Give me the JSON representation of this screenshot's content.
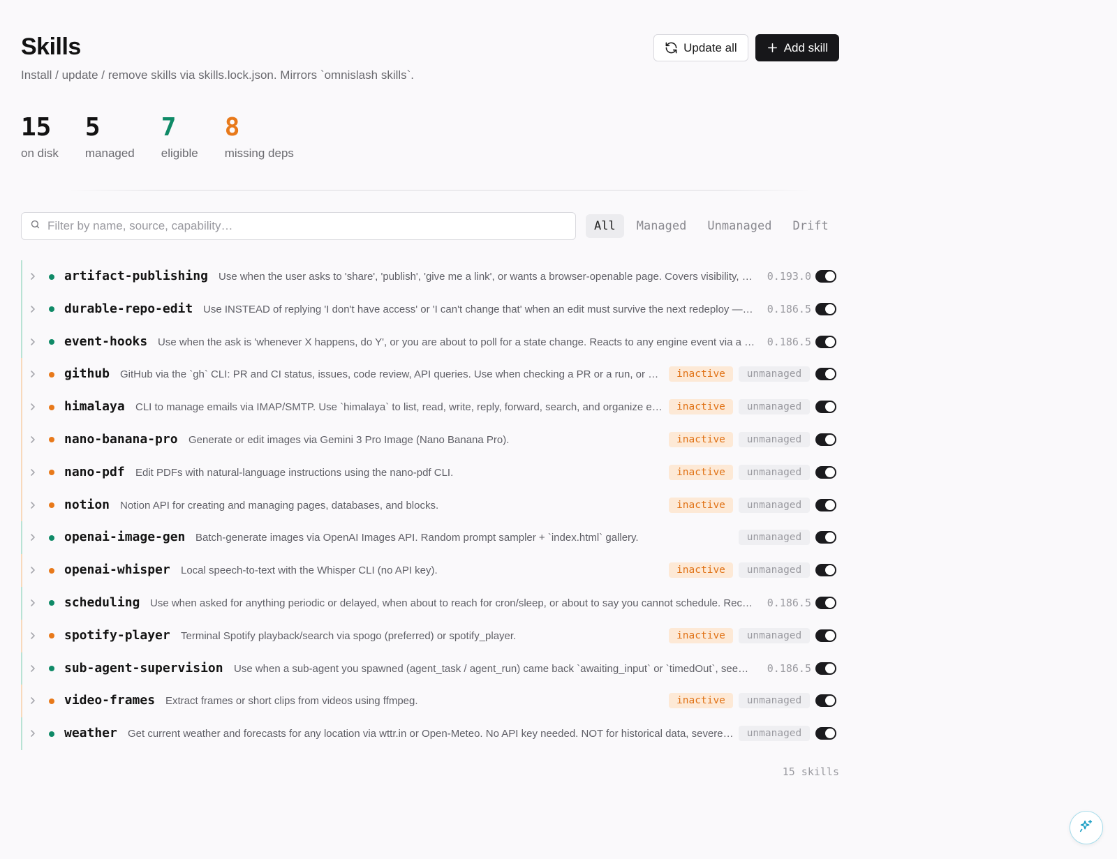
{
  "header": {
    "title": "Skills",
    "subtitle": "Install / update / remove skills via skills.lock.json. Mirrors `omnislash skills`.",
    "update_all_label": "Update all",
    "add_skill_label": "Add skill"
  },
  "stats": [
    {
      "value": "15",
      "label": "on disk",
      "color": "#121212"
    },
    {
      "value": "5",
      "label": "managed",
      "color": "#121212"
    },
    {
      "value": "7",
      "label": "eligible",
      "color": "#0f8a67"
    },
    {
      "value": "8",
      "label": "missing deps",
      "color": "#e8791a"
    }
  ],
  "filter": {
    "placeholder": "Filter by name, source, capability…",
    "tabs": [
      "All",
      "Managed",
      "Unmanaged",
      "Drift"
    ],
    "active_tab": "All"
  },
  "skills": [
    {
      "name": "artifact-publishing",
      "desc": "Use when the user asks to 'share', 'publish', 'give me a link', or wants a browser-openable page. Covers visibility, ex…",
      "status": "ok",
      "version": "0.193.0",
      "inactive": false,
      "unmanaged": false,
      "enabled": true
    },
    {
      "name": "durable-repo-edit",
      "desc": "Use INSTEAD of replying 'I don't have access' or 'I can't change that' when an edit must survive the next redeploy — co…",
      "status": "ok",
      "version": "0.186.5",
      "inactive": false,
      "unmanaged": false,
      "enabled": true
    },
    {
      "name": "event-hooks",
      "desc": "Use when the ask is 'whenever X happens, do Y', or you are about to poll for a state change. Reacts to any engine event via a `*.…",
      "status": "ok",
      "version": "0.186.5",
      "inactive": false,
      "unmanaged": false,
      "enabled": true
    },
    {
      "name": "github",
      "desc": "GitHub via the `gh` CLI: PR and CI status, issues, code review, API queries. Use when checking a PR or a run, or c…",
      "status": "warn",
      "version": "",
      "inactive": true,
      "unmanaged": true,
      "enabled": true
    },
    {
      "name": "himalaya",
      "desc": "CLI to manage emails via IMAP/SMTP. Use `himalaya` to list, read, write, reply, forward, search, and organize e…",
      "status": "warn",
      "version": "",
      "inactive": true,
      "unmanaged": true,
      "enabled": true
    },
    {
      "name": "nano-banana-pro",
      "desc": "Generate or edit images via Gemini 3 Pro Image (Nano Banana Pro).",
      "status": "warn",
      "version": "",
      "inactive": true,
      "unmanaged": true,
      "enabled": true
    },
    {
      "name": "nano-pdf",
      "desc": "Edit PDFs with natural-language instructions using the nano-pdf CLI.",
      "status": "warn",
      "version": "",
      "inactive": true,
      "unmanaged": true,
      "enabled": true
    },
    {
      "name": "notion",
      "desc": "Notion API for creating and managing pages, databases, and blocks.",
      "status": "warn",
      "version": "",
      "inactive": true,
      "unmanaged": true,
      "enabled": true
    },
    {
      "name": "openai-image-gen",
      "desc": "Batch-generate images via OpenAI Images API. Random prompt sampler + `index.html` gallery.",
      "status": "ok",
      "version": "",
      "inactive": false,
      "unmanaged": true,
      "enabled": true
    },
    {
      "name": "openai-whisper",
      "desc": "Local speech-to-text with the Whisper CLI (no API key).",
      "status": "warn",
      "version": "",
      "inactive": true,
      "unmanaged": true,
      "enabled": true
    },
    {
      "name": "scheduling",
      "desc": "Use when asked for anything periodic or delayed, when about to reach for cron/sleep, or about to say you cannot schedule. Recurr…",
      "status": "ok",
      "version": "0.186.5",
      "inactive": false,
      "unmanaged": false,
      "enabled": true
    },
    {
      "name": "spotify-player",
      "desc": "Terminal Spotify playback/search via spogo (preferred) or spotify_player.",
      "status": "warn",
      "version": "",
      "inactive": true,
      "unmanaged": true,
      "enabled": true
    },
    {
      "name": "sub-agent-supervision",
      "desc": "Use when a sub-agent you spawned (agent_task / agent_run) came back `awaiting_input` or `timedOut`, seems …",
      "status": "ok",
      "version": "0.186.5",
      "inactive": false,
      "unmanaged": false,
      "enabled": true
    },
    {
      "name": "video-frames",
      "desc": "Extract frames or short clips from videos using ffmpeg.",
      "status": "warn",
      "version": "",
      "inactive": true,
      "unmanaged": true,
      "enabled": true
    },
    {
      "name": "weather",
      "desc": "Get current weather and forecasts for any location via wttr.in or Open-Meteo. No API key needed. NOT for historical data, severe-…",
      "status": "ok",
      "version": "",
      "inactive": false,
      "unmanaged": true,
      "enabled": true
    }
  ],
  "badges": {
    "inactive": "inactive",
    "unmanaged": "unmanaged"
  },
  "footer": {
    "count": "15 skills"
  },
  "icons": {
    "refresh": "refresh-icon",
    "plus": "plus-icon",
    "search": "search-icon",
    "chevron": "chevron-right-icon",
    "assistant": "sparkles-icon"
  }
}
